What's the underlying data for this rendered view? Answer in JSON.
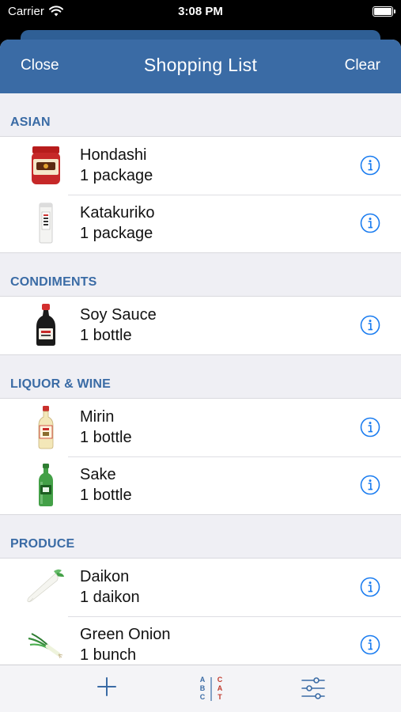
{
  "status": {
    "carrier": "Carrier",
    "time": "3:08 PM"
  },
  "nav": {
    "close": "Close",
    "title": "Shopping List",
    "clear": "Clear"
  },
  "sections": [
    {
      "title": "ASIAN",
      "items": [
        {
          "name": "Hondashi",
          "qty": "1 package",
          "icon": "hondashi-jar-icon"
        },
        {
          "name": "Katakuriko",
          "qty": "1 package",
          "icon": "katakuriko-package-icon"
        }
      ]
    },
    {
      "title": "CONDIMENTS",
      "items": [
        {
          "name": "Soy Sauce",
          "qty": "1 bottle",
          "icon": "soy-sauce-bottle-icon"
        }
      ]
    },
    {
      "title": "LIQUOR & WINE",
      "items": [
        {
          "name": "Mirin",
          "qty": "1 bottle",
          "icon": "mirin-bottle-icon"
        },
        {
          "name": "Sake",
          "qty": "1 bottle",
          "icon": "sake-bottle-icon"
        }
      ]
    },
    {
      "title": "PRODUCE",
      "items": [
        {
          "name": "Daikon",
          "qty": "1 daikon",
          "icon": "daikon-icon"
        },
        {
          "name": "Green Onion",
          "qty": "1 bunch",
          "icon": "green-onion-icon"
        }
      ]
    }
  ],
  "toolbar": {
    "sort_abc": "A B C",
    "sort_cat": "C A T",
    "add_icon": "plus-icon",
    "filter_icon": "sliders-icon"
  },
  "colors": {
    "accent": "#3a6ba5",
    "info_blue": "#1a7cf0",
    "background": "#efeff4"
  }
}
